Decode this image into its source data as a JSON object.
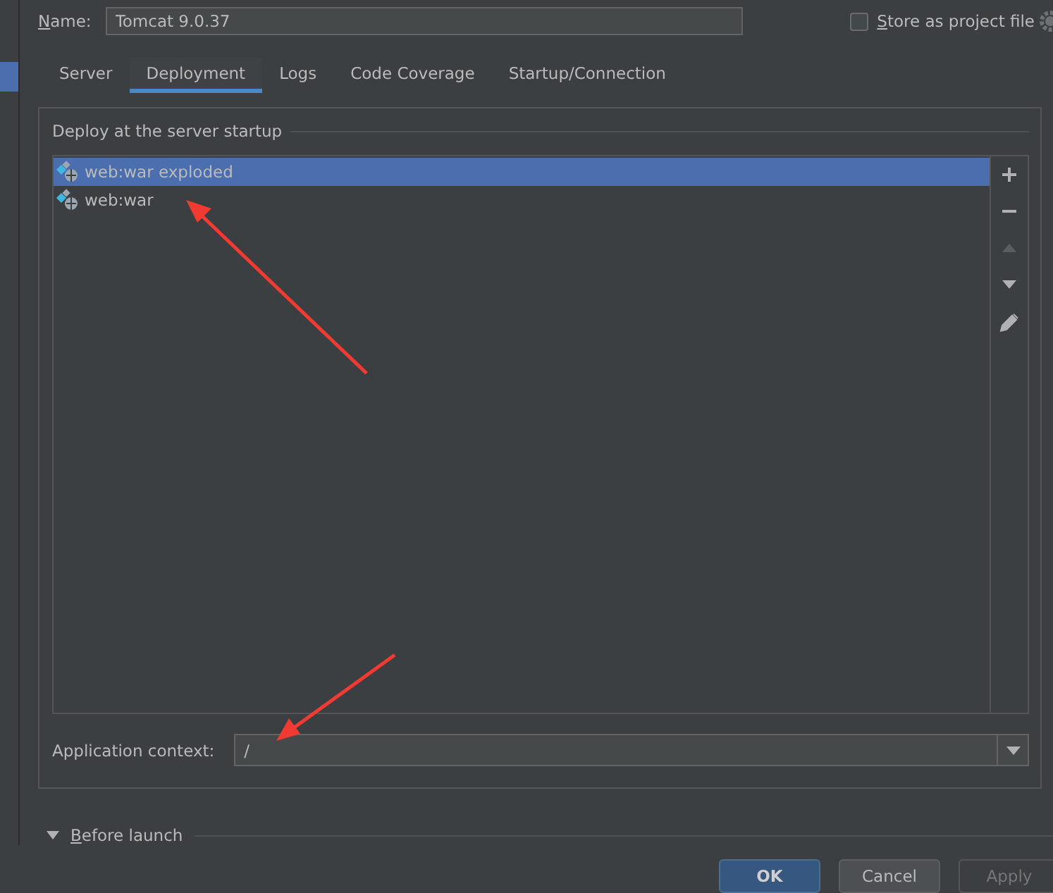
{
  "name_field": {
    "label": "Name:",
    "value": "Tomcat 9.0.37"
  },
  "store_as_project_file": {
    "label": "Store as project file",
    "checked": false
  },
  "tabs": [
    {
      "label": "Server",
      "selected": false
    },
    {
      "label": "Deployment",
      "selected": true
    },
    {
      "label": "Logs",
      "selected": false
    },
    {
      "label": "Code Coverage",
      "selected": false
    },
    {
      "label": "Startup/Connection",
      "selected": false
    }
  ],
  "deployment": {
    "title": "Deploy at the server startup",
    "artifacts": [
      {
        "label": "web:war exploded",
        "selected": true
      },
      {
        "label": "web:war",
        "selected": false
      }
    ],
    "application_context": {
      "label": "Application context:",
      "value": "/"
    }
  },
  "before_launch": {
    "label": "Before launch"
  },
  "buttons": [
    {
      "label": "OK",
      "kind": "default"
    },
    {
      "label": "Cancel",
      "kind": "normal"
    },
    {
      "label": "Apply",
      "kind": "disabled"
    }
  ]
}
